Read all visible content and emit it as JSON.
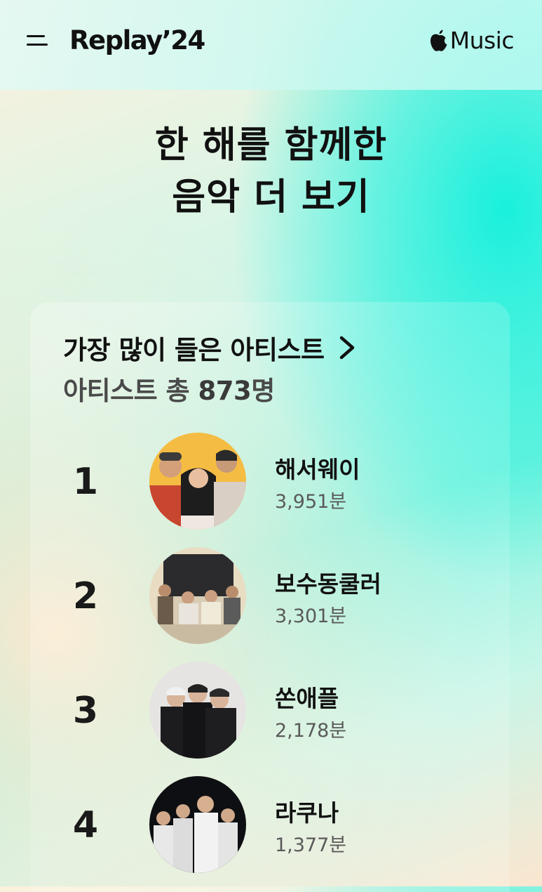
{
  "header": {
    "brand": "Replay’24",
    "apple_music_label": "Music"
  },
  "headline": {
    "line1": "한 해를 함께한",
    "line2": "음악 더 보기"
  },
  "section": {
    "title": "가장 많이 들은 아티스트",
    "subtitle_prefix": "아티스트 총 ",
    "subtitle_count": "873",
    "subtitle_suffix": "명"
  },
  "artists": [
    {
      "rank": "1",
      "name": "해서웨이",
      "minutes": "3,951분"
    },
    {
      "rank": "2",
      "name": "보수동쿨러",
      "minutes": "3,301분"
    },
    {
      "rank": "3",
      "name": "쏜애플",
      "minutes": "2,178분"
    },
    {
      "rank": "4",
      "name": "라쿠나",
      "minutes": "1,377분"
    }
  ]
}
